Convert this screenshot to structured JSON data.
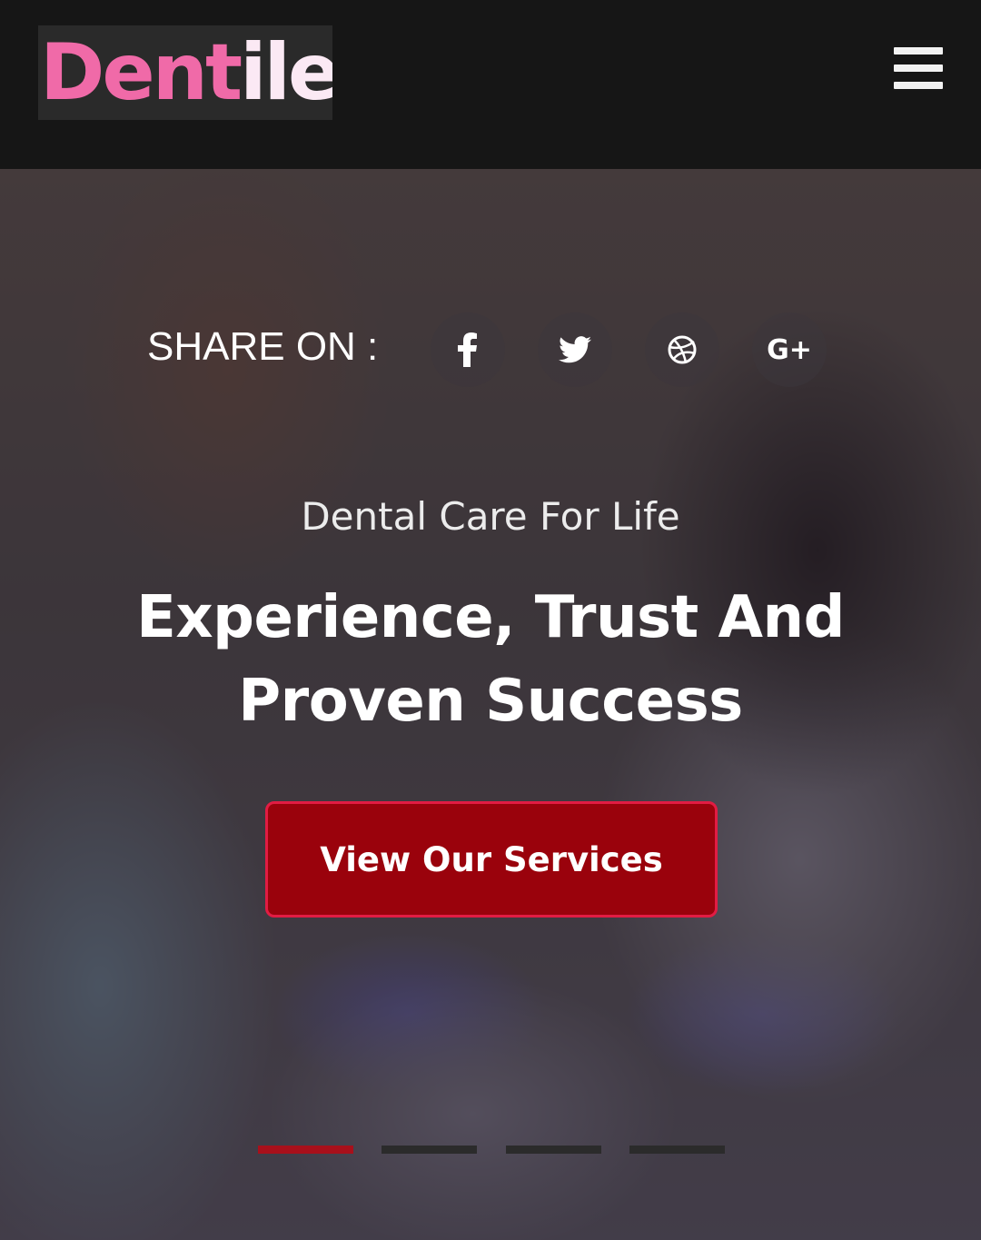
{
  "header": {
    "logo_part1": "Dent",
    "logo_part2": "ile",
    "menu_icon": "hamburger-menu-icon"
  },
  "hero": {
    "share_label": "SHARE ON :",
    "social": [
      {
        "icon": "facebook-icon",
        "text": "f"
      },
      {
        "icon": "twitter-icon"
      },
      {
        "icon": "dribbble-icon"
      },
      {
        "icon": "google-plus-icon",
        "text": "G+"
      }
    ],
    "subtitle": "Dental Care For Life",
    "headline_line1": "Experience, Trust And",
    "headline_line2": "Proven Success",
    "cta_label": "View Our Services",
    "slider": {
      "total": 4,
      "active_index": 0
    }
  },
  "colors": {
    "logo_pink": "#f06aa8",
    "logo_light": "#fbe9f4",
    "cta_bg": "#9a020c",
    "cta_border": "#e21c43",
    "slider_active": "#a8101b",
    "slider_inactive": "#2b2b2b"
  }
}
